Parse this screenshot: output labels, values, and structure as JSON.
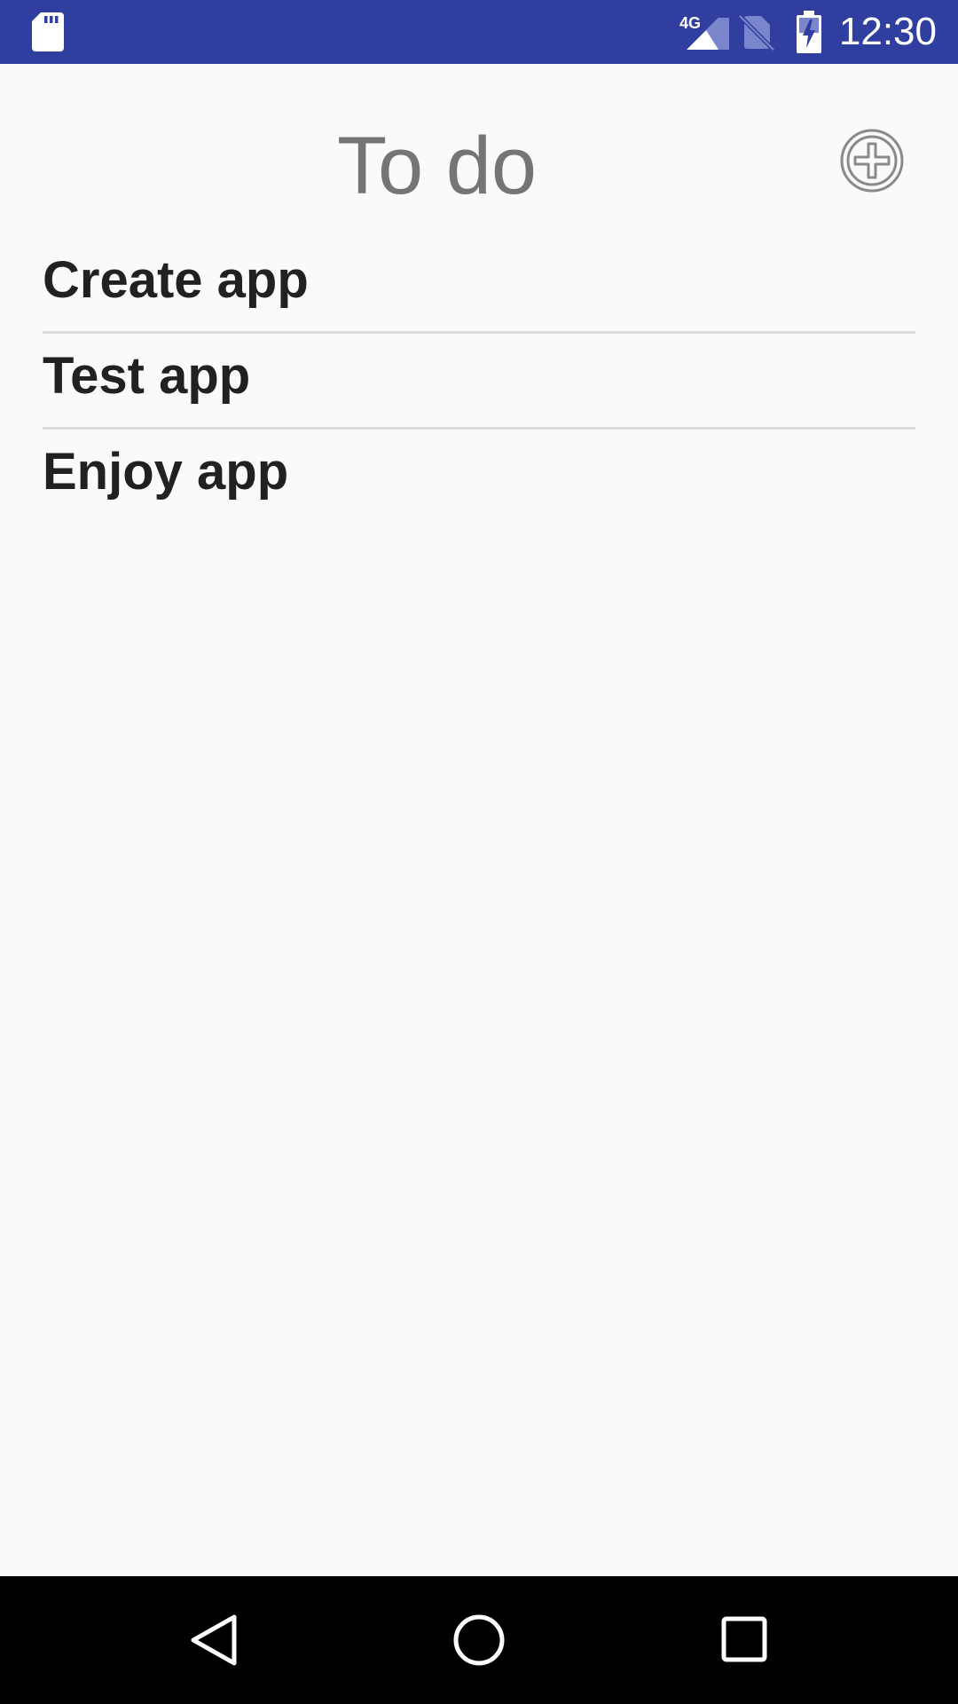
{
  "status_bar": {
    "network_label": "4G",
    "time": "12:30",
    "background_color": "#303f9f",
    "icons": [
      "sd-card-icon",
      "signal-icon",
      "no-sim-icon",
      "battery-charging-icon"
    ]
  },
  "header": {
    "title": "To do",
    "add_icon": "add-circle-icon"
  },
  "todo_items": [
    {
      "label": "Create app"
    },
    {
      "label": "Test app"
    },
    {
      "label": "Enjoy app"
    }
  ],
  "nav_bar": {
    "buttons": [
      "back-icon",
      "home-icon",
      "recents-icon"
    ]
  }
}
